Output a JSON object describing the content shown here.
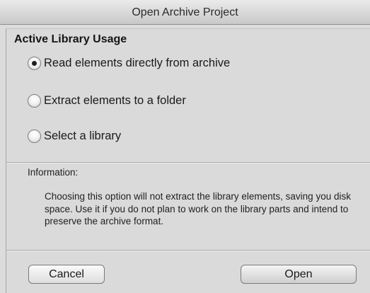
{
  "window": {
    "title": "Open Archive Project"
  },
  "section": {
    "title": "Active Library Usage"
  },
  "options": [
    {
      "label": "Read elements directly from archive",
      "selected": true
    },
    {
      "label": "Extract elements to a folder",
      "selected": false
    },
    {
      "label": "Select a library",
      "selected": false
    }
  ],
  "information": {
    "label": "Information:",
    "text": "Choosing this option will not extract the library elements, saving you disk space. Use it if you do not plan to work on the library parts and intend to preserve the archive format."
  },
  "buttons": {
    "cancel": "Cancel",
    "open": "Open"
  }
}
